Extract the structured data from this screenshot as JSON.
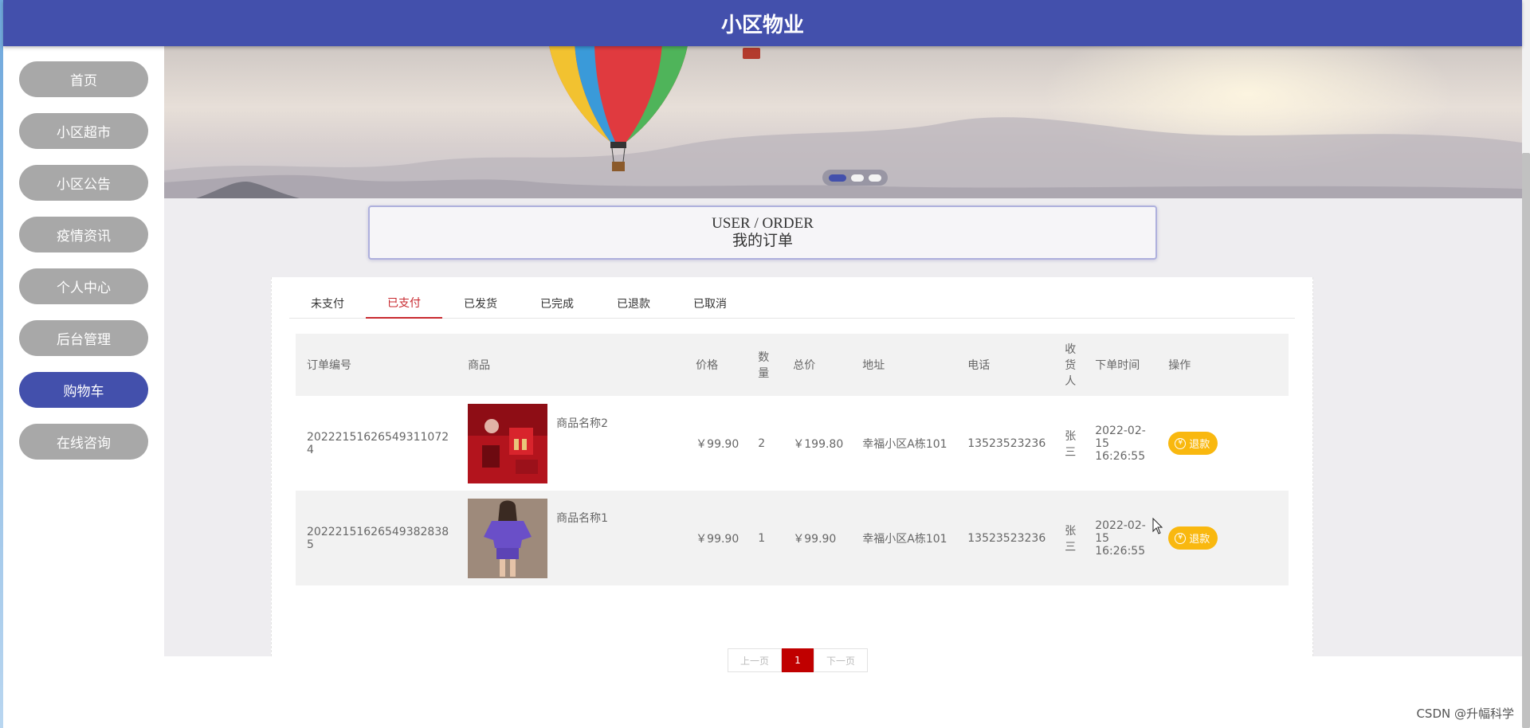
{
  "header": {
    "title": "小区物业"
  },
  "sidebar": {
    "items": [
      {
        "label": "首页"
      },
      {
        "label": "小区超市"
      },
      {
        "label": "小区公告"
      },
      {
        "label": "疫情资讯"
      },
      {
        "label": "个人中心"
      },
      {
        "label": "后台管理"
      },
      {
        "label": "购物车"
      },
      {
        "label": "在线咨询"
      }
    ],
    "active_index": 6
  },
  "banner": {
    "slides_count": 3,
    "active_slide": 0
  },
  "section": {
    "title_en": "USER / ORDER",
    "title_cn": "我的订单"
  },
  "tabs": {
    "items": [
      {
        "label": "未支付"
      },
      {
        "label": "已支付"
      },
      {
        "label": "已发货"
      },
      {
        "label": "已完成"
      },
      {
        "label": "已退款"
      },
      {
        "label": "已取消"
      }
    ],
    "active_index": 1
  },
  "table": {
    "columns": [
      "订单编号",
      "商品",
      "价格",
      "数量",
      "总价",
      "地址",
      "电话",
      "收货人",
      "下单时间",
      "操作"
    ],
    "rows": [
      {
        "order_no": "20222151626549311072​4",
        "goods_name": "商品名称2",
        "goods_image": "red-cosmetics-image",
        "price": "￥99.90",
        "quantity": "2",
        "total": "￥199.80",
        "address": "幸福小区A栋101",
        "phone": "13523523236",
        "receiver": "张三",
        "order_time": "2022-02-15 16:26:55",
        "action": "退款"
      },
      {
        "order_no": "20222151626549382838​5",
        "goods_name": "商品名称1",
        "goods_image": "purple-outfit-image",
        "price": "￥99.90",
        "quantity": "1",
        "total": "￥99.90",
        "address": "幸福小区A栋101",
        "phone": "13523523236",
        "receiver": "张三",
        "order_time": "2022-02-15 16:26:55",
        "action": "退款"
      }
    ]
  },
  "pager": {
    "prev": "上一页",
    "current": "1",
    "next": "下一页"
  },
  "watermark": "CSDN @升幅科学",
  "colors": {
    "header": "#4350ac",
    "nav_inactive": "#a8a8a8",
    "nav_active": "#4350ac",
    "tab_active": "#c8292f",
    "refund_button": "#f9b80f",
    "pager_current": "#c00000"
  }
}
